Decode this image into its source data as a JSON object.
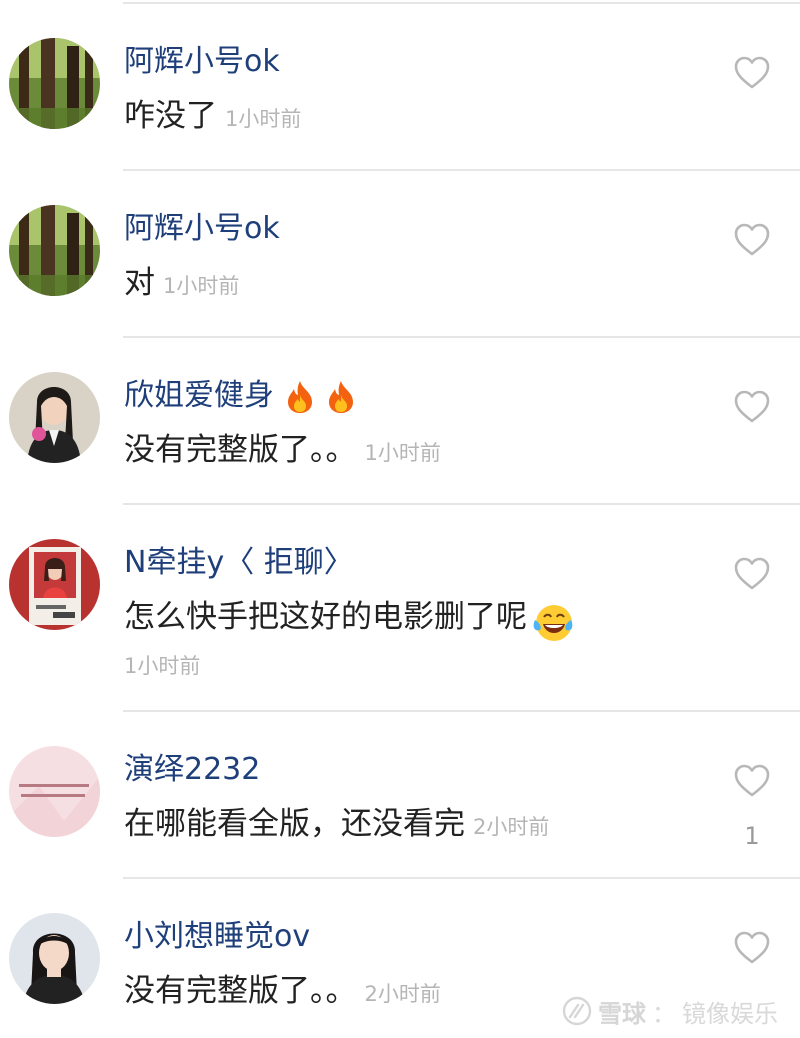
{
  "comments": [
    {
      "username": "阿辉小号ok",
      "text": "咋没了",
      "time": "1小时前",
      "likes": "",
      "avatar_icon": "forest-avatar-icon"
    },
    {
      "username": "阿辉小号ok",
      "text": "对",
      "time": "1小时前",
      "likes": "",
      "avatar_icon": "forest-avatar-icon"
    },
    {
      "username": "欣姐爱健身",
      "text": "没有完整版了。。",
      "time": "1小时前",
      "likes": "",
      "avatar_icon": "woman-portrait-avatar-icon",
      "name_emoji": "fire-emoji"
    },
    {
      "username": "N牵挂y〈 拒聊〉",
      "text": "怎么快手把这好的电影删了呢",
      "time": "1小时前",
      "likes": "",
      "avatar_icon": "photo-card-avatar-icon",
      "text_emoji": "crying-laughing-emoji"
    },
    {
      "username": "演绎2232",
      "text": "在哪能看全版，还没看完",
      "time": "2小时前",
      "likes": "1",
      "avatar_icon": "pink-text-avatar-icon"
    },
    {
      "username": "小刘想睡觉ov",
      "text": "没有完整版了。。",
      "time": "2小时前",
      "likes": "",
      "avatar_icon": "girl-portrait-avatar-icon"
    }
  ],
  "watermark": {
    "brand": "雪球",
    "separator": "：",
    "account": "镜像娱乐"
  },
  "colors": {
    "username": "#1f3f7a",
    "text": "#222222",
    "time": "#b5b5b5",
    "heart": "#b8b8b8",
    "divider": "#e6e6e6"
  }
}
